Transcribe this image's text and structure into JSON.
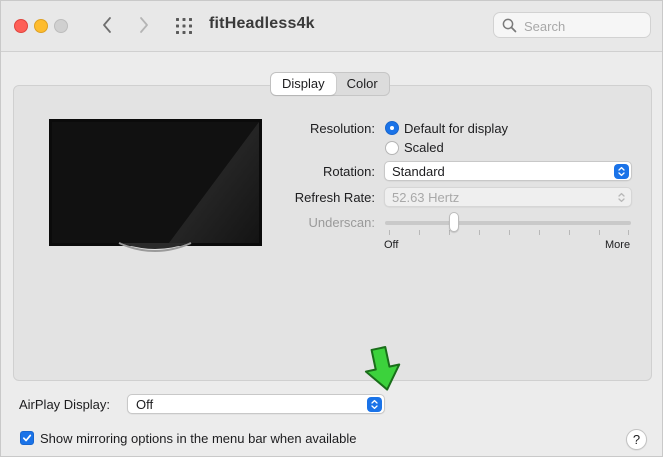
{
  "window": {
    "title": "fitHeadless4k"
  },
  "toolbar": {
    "back_icon": "chevron-left-icon",
    "forward_icon": "chevron-right-icon",
    "grid_icon": "grid-icon"
  },
  "search": {
    "placeholder": "Search",
    "value": ""
  },
  "tabs": [
    {
      "label": "Display",
      "active": true
    },
    {
      "label": "Color",
      "active": false
    }
  ],
  "resolution": {
    "label": "Resolution:",
    "options": [
      {
        "label": "Default for display",
        "selected": true
      },
      {
        "label": "Scaled",
        "selected": false
      }
    ]
  },
  "rotation": {
    "label": "Rotation:",
    "value": "Standard"
  },
  "refresh_rate": {
    "label": "Refresh Rate:",
    "value": "52.63 Hertz",
    "enabled": false
  },
  "underscan": {
    "label": "Underscan:",
    "min_label": "Off",
    "max_label": "More",
    "value_fraction": 0.28
  },
  "airplay": {
    "label": "AirPlay Display:",
    "value": "Off"
  },
  "mirroring": {
    "label": "Show mirroring options in the menu bar when available",
    "checked": true
  },
  "help": {
    "label": "?"
  },
  "colors": {
    "accent": "#1a73e8",
    "annotation_arrow": "#3cd23c"
  }
}
